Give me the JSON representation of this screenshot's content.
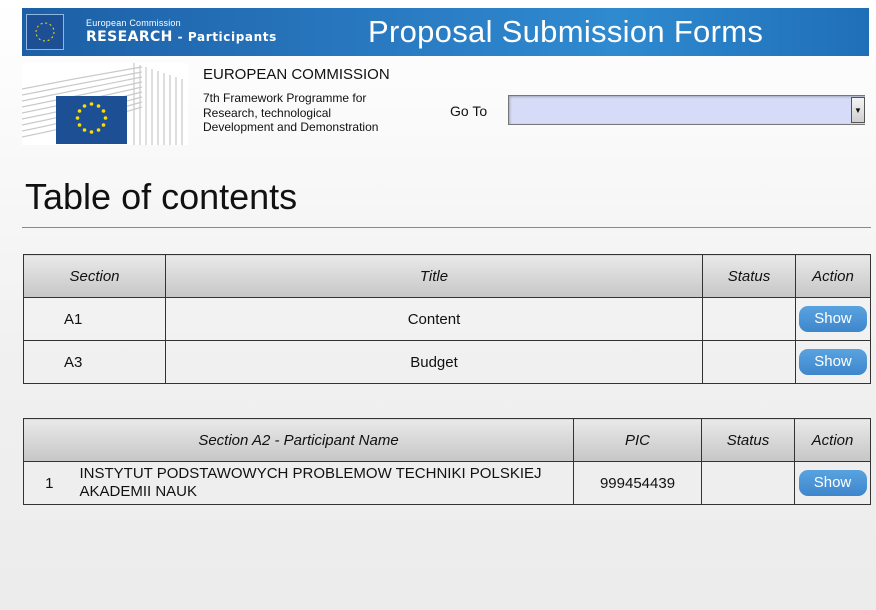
{
  "banner": {
    "small_text": "European Commission",
    "brand_main": "RESEARCH",
    "brand_sub": " - Participants",
    "title": "Proposal Submission Forms"
  },
  "header": {
    "org_name": "EUROPEAN COMMISSION",
    "org_sub": "7th Framework Programme for Research, technological Development and Demonstration",
    "goto_label": "Go To",
    "goto_value": ""
  },
  "toc": {
    "title": "Table of contents",
    "columns": [
      "Section",
      "Title",
      "Status",
      "Action"
    ],
    "rows": [
      {
        "section": "A1",
        "title": "Content",
        "status": "",
        "action": "Show"
      },
      {
        "section": "A3",
        "title": "Budget",
        "status": "",
        "action": "Show"
      }
    ]
  },
  "participants": {
    "columns": [
      "Section A2 - Participant Name",
      "PIC",
      "Status",
      "Action"
    ],
    "rows": [
      {
        "number": "1",
        "name": "INSTYTUT PODSTAWOWYCH PROBLEMOW TECHNIKI POLSKIEJ AKADEMII NAUK",
        "pic": "999454439",
        "status": "",
        "action": "Show"
      }
    ]
  },
  "colors": {
    "banner_blue": "#2a7bc2",
    "select_bg": "#d6dcf7",
    "button_blue": "#4a94d6",
    "eu_blue": "#1d4f95",
    "eu_star": "#ffdd00"
  },
  "icons": {
    "banner_flag": "eu-flag-icon",
    "logo": "berlaymont-logo",
    "dropdown": "dropdown-arrow-icon"
  }
}
